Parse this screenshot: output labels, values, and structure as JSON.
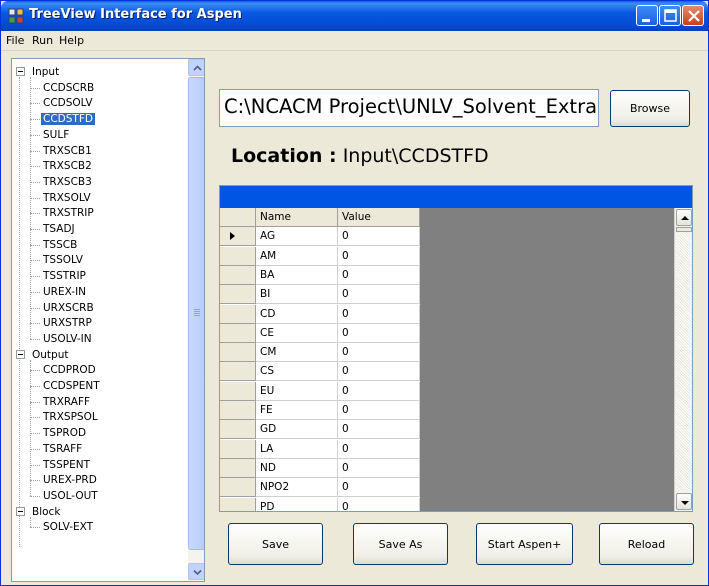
{
  "window": {
    "title": "TreeView Interface for Aspen"
  },
  "menu": [
    "File",
    "Run",
    "Help"
  ],
  "tree": {
    "groups": [
      {
        "label": "Input",
        "children": [
          "CCDSCRB",
          "CCDSOLV",
          "CCDSTFD",
          "SULF",
          "TRXSCB1",
          "TRXSCB2",
          "TRXSCB3",
          "TRXSOLV",
          "TRXSTRIP",
          "TSADJ",
          "TSSCB",
          "TSSOLV",
          "TSSTRIP",
          "UREX-IN",
          "URXSCRB",
          "URXSTRP",
          "USOLV-IN"
        ]
      },
      {
        "label": "Output",
        "children": [
          "CCDPROD",
          "CCDSPENT",
          "TRXRAFF",
          "TRXSPSOL",
          "TSPROD",
          "TSRAFF",
          "TSSPENT",
          "UREX-PRD",
          "USOL-OUT"
        ]
      },
      {
        "label": "Block",
        "children": [
          "SOLV-EXT"
        ]
      }
    ],
    "selected": "CCDSTFD"
  },
  "path": {
    "value": "C:\\NCACM Project\\UNLV_Solvent_Extra"
  },
  "browse_label": "Browse",
  "location": {
    "label": "Location :",
    "value": "Input\\CCDSTFD"
  },
  "grid": {
    "columns": [
      "Name",
      "Value"
    ],
    "rows": [
      [
        "AG",
        "0"
      ],
      [
        "AM",
        "0"
      ],
      [
        "BA",
        "0"
      ],
      [
        "BI",
        "0"
      ],
      [
        "CD",
        "0"
      ],
      [
        "CE",
        "0"
      ],
      [
        "CM",
        "0"
      ],
      [
        "CS",
        "0"
      ],
      [
        "EU",
        "0"
      ],
      [
        "FE",
        "0"
      ],
      [
        "GD",
        "0"
      ],
      [
        "LA",
        "0"
      ],
      [
        "ND",
        "0"
      ],
      [
        "NPO2",
        "0"
      ],
      [
        "PD",
        "0"
      ]
    ],
    "current_row": 0
  },
  "buttons": {
    "save": "Save",
    "save_as": "Save As",
    "start": "Start Aspen+",
    "reload": "Reload"
  },
  "colors": {
    "titlebar": "#0454d8",
    "selection": "#316ac5",
    "grid_caption": "#0055e5"
  }
}
